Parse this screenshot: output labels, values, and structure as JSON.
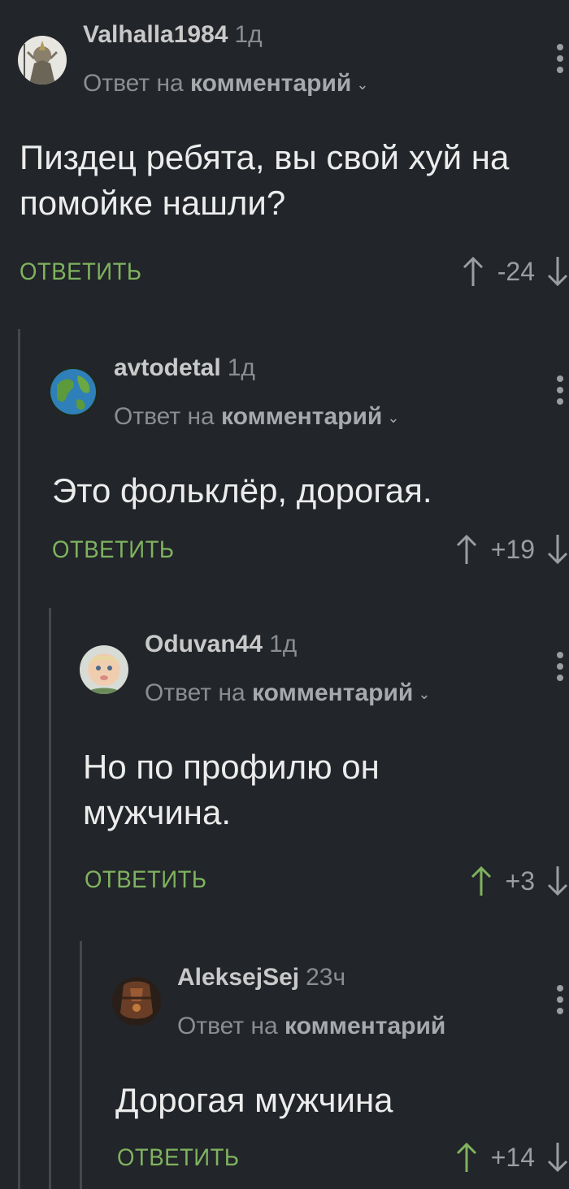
{
  "comments": [
    {
      "username": "Valhalla1984",
      "time": "1д",
      "reply_prefix": "Ответ на",
      "reply_target": "комментарий",
      "has_chevron": true,
      "text": "Пиздец ребята, вы свой хуй на помойке нашли?",
      "reply_label": "ОТВЕТИТЬ",
      "score": "-24",
      "upvoted": false
    },
    {
      "username": "avtodetal",
      "time": "1д",
      "reply_prefix": "Ответ на",
      "reply_target": "комментарий",
      "has_chevron": true,
      "text": "Это фольклёр, дорогая.",
      "reply_label": "ОТВЕТИТЬ",
      "score": "+19",
      "upvoted": false
    },
    {
      "username": "Oduvan44",
      "time": "1д",
      "reply_prefix": "Ответ на",
      "reply_target": "комментарий",
      "has_chevron": true,
      "text": "Но по профилю он мужчина.",
      "reply_label": "ОТВЕТИТЬ",
      "score": "+3",
      "upvoted": true
    },
    {
      "username": "AleksejSej",
      "time": "23ч",
      "reply_prefix": "Ответ на",
      "reply_target": "комментарий",
      "has_chevron": false,
      "text": "Дорогая мужчина",
      "reply_label": "ОТВЕТИТЬ",
      "score": "+14",
      "upvoted": true
    }
  ],
  "icons": {
    "avatar_1": "knight-avatar",
    "avatar_2": "globe-avatar",
    "avatar_3": "baby-avatar",
    "avatar_4": "armor-avatar",
    "vote_up": "arrow-up-icon",
    "vote_down": "arrow-down-icon",
    "menu": "kebab-menu-icon"
  },
  "colors": {
    "background": "#222529",
    "reply_button": "#7fb35f",
    "upvoted_arrow": "#7fb35f",
    "muted_text": "#8a8d91",
    "thread_line": "#45484c"
  }
}
